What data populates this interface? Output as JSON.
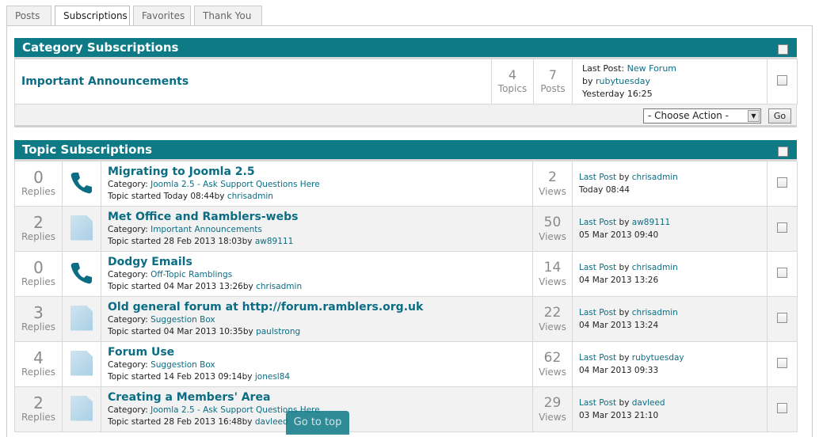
{
  "tabs": [
    {
      "label": "Posts"
    },
    {
      "label": "Subscriptions"
    },
    {
      "label": "Favorites"
    },
    {
      "label": "Thank You"
    }
  ],
  "category_section": {
    "title": "Category Subscriptions",
    "category": {
      "name": "Important Announcements",
      "topics_count": "4",
      "topics_label": "Topics",
      "posts_count": "7",
      "posts_label": "Posts",
      "last_post_label": "Last Post:",
      "last_post_title": "New Forum",
      "by_label": "by",
      "last_post_author": "rubytuesday",
      "last_post_time": "Yesterday 16:25"
    },
    "action_select_value": "- Choose Action -",
    "go_label": "Go"
  },
  "topic_section": {
    "title": "Topic Subscriptions",
    "replies_label": "Replies",
    "views_label": "Views",
    "category_label": "Category:",
    "started_label": "Topic started",
    "by_label": "by",
    "last_post_label": "Last Post",
    "topics": [
      {
        "replies": "0",
        "icon": "phone-icon",
        "title": "Migrating to Joomla 2.5",
        "category": "Joomla 2.5 - Ask Support Questions Here",
        "started": "Today 08:44",
        "author": "chrisadmin",
        "views": "2",
        "last_author": "chrisadmin",
        "last_time": "Today 08:44"
      },
      {
        "replies": "2",
        "icon": "document-icon",
        "title": "Met Office and Ramblers-webs",
        "category": "Important Announcements",
        "started": "28 Feb 2013 18:03",
        "author": "aw89111",
        "views": "50",
        "last_author": "aw89111",
        "last_time": "05 Mar 2013 09:40"
      },
      {
        "replies": "0",
        "icon": "phone-icon",
        "title": "Dodgy Emails",
        "category": "Off-Topic Ramblings",
        "started": "04 Mar 2013 13:26",
        "author": "chrisadmin",
        "views": "14",
        "last_author": "chrisadmin",
        "last_time": "04 Mar 2013 13:26"
      },
      {
        "replies": "3",
        "icon": "document-icon",
        "title": "Old general forum at http://forum.ramblers.org.uk",
        "category": "Suggestion Box",
        "started": "04 Mar 2013 10:35",
        "author": "paulstrong",
        "views": "22",
        "last_author": "chrisadmin",
        "last_time": "04 Mar 2013 13:24"
      },
      {
        "replies": "4",
        "icon": "document-icon",
        "title": "Forum Use",
        "category": "Suggestion Box",
        "started": "14 Feb 2013 09:14",
        "author": "jonesl84",
        "views": "62",
        "last_author": "rubytuesday",
        "last_time": "04 Mar 2013 09:33"
      },
      {
        "replies": "2",
        "icon": "document-icon",
        "title": "Creating a Members' Area",
        "category": "Joomla 2.5 - Ask Support Questions Here",
        "started": "28 Feb 2013 16:48",
        "author": "davleed",
        "views": "29",
        "last_author": "davleed",
        "last_time": "03 Mar 2013 21:10"
      }
    ]
  },
  "goto_top_label": "Go to top",
  "colors": {
    "header_bg": "#0e7a86",
    "link": "#0b6d84",
    "alt_row": "#f2f2f2"
  }
}
